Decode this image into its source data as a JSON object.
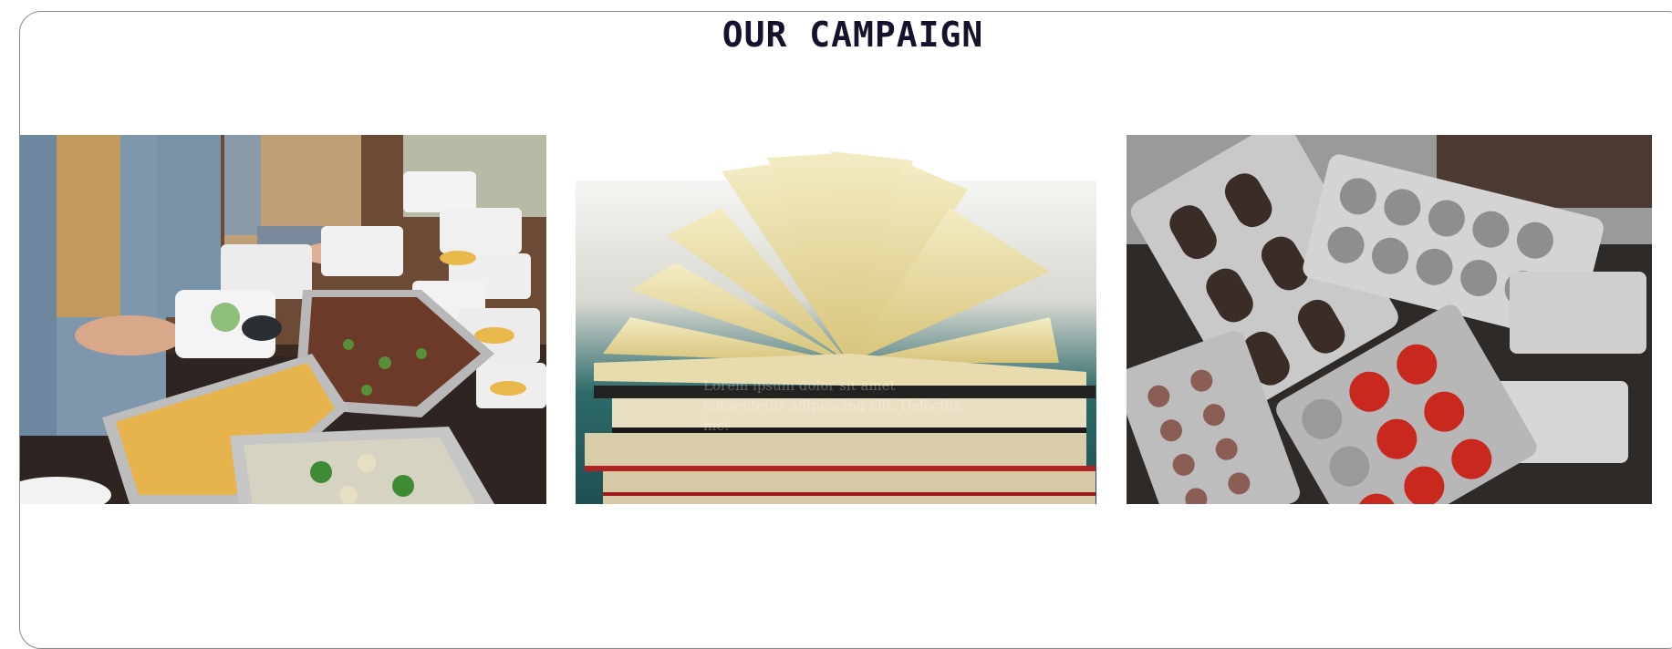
{
  "section": {
    "title": "OUR CAMPAIGN"
  },
  "cards": [
    {
      "subject": "food-donation-photo"
    },
    {
      "subject": "books-photo",
      "overlay_text": "Lorem ipsum dolor sit amet consectetur adipisicing elit. Delectus, hic!"
    },
    {
      "subject": "medicine-photo"
    }
  ],
  "colors": {
    "title": "#16122e",
    "frame_border": "#8a8a8a",
    "background": "#ffffff"
  }
}
